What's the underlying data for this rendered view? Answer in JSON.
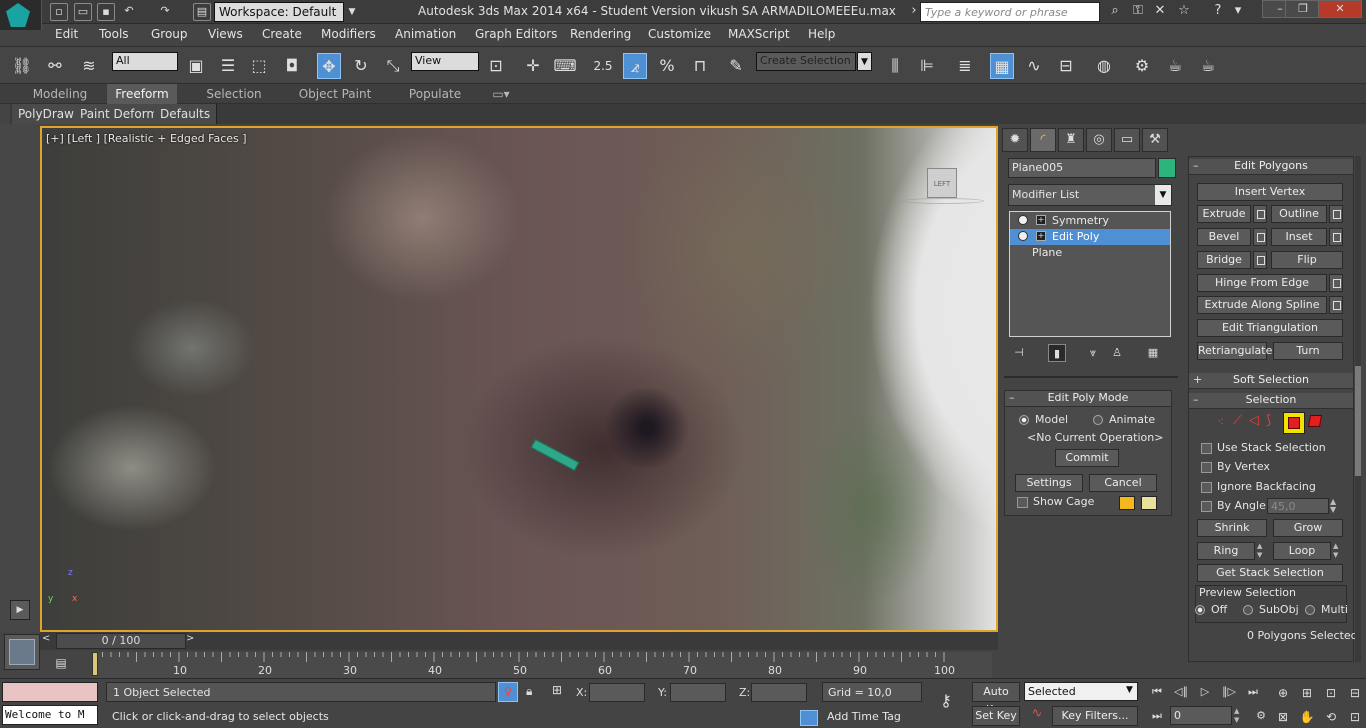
{
  "window": {
    "workspace": "Workspace: Default",
    "title": "Autodesk 3ds Max  2014 x64  - Student Version    vikush SA ARMADILOMEEEu.max",
    "search_placeholder": "Type a keyword or phrase"
  },
  "menu": [
    "Edit",
    "Tools",
    "Group",
    "Views",
    "Create",
    "Modifiers",
    "Animation",
    "Graph Editors",
    "Rendering",
    "Customize",
    "MAXScript",
    "Help"
  ],
  "toolbar": {
    "selection_filter": "All",
    "reference_coord": "View",
    "snap_value": "2.5",
    "named_selection_placeholder": "Create Selection Se"
  },
  "ribbon": {
    "tabs": [
      "Modeling",
      "Freeform",
      "Selection",
      "Object Paint",
      "Populate"
    ],
    "active_tab": "Freeform",
    "subtabs": [
      "PolyDraw",
      "Paint Deform",
      "Defaults"
    ]
  },
  "viewport": {
    "label": "[+] [Left ] [Realistic + Edged Faces ]",
    "viewcube_label": "LEFT",
    "axis": {
      "x": "x",
      "y": "y",
      "z": "z"
    }
  },
  "command_panel": {
    "object_name": "Plane005",
    "object_color": "#2bb37b",
    "modifier_list": "Modifier List",
    "stack": [
      {
        "label": "Symmetry",
        "selected": false
      },
      {
        "label": "Edit Poly",
        "selected": true
      },
      {
        "label": "Plane",
        "selected": false
      }
    ],
    "edit_poly_mode": {
      "title": "Edit Poly Mode",
      "model": "Model",
      "animate": "Animate",
      "current_op": "<No Current Operation>",
      "commit": "Commit",
      "settings": "Settings",
      "cancel": "Cancel",
      "show_cage": "Show Cage",
      "cage_color_1": "#f4b81c",
      "cage_color_2": "#e8e29a"
    },
    "edit_polygons": {
      "title": "Edit Polygons",
      "insert_vertex": "Insert Vertex",
      "extrude": "Extrude",
      "outline": "Outline",
      "bevel": "Bevel",
      "inset": "Inset",
      "bridge": "Bridge",
      "flip": "Flip",
      "hinge": "Hinge From Edge",
      "extrude_spline": "Extrude Along Spline",
      "edit_tri": "Edit Triangulation",
      "retriangulate": "Retriangulate",
      "turn": "Turn"
    },
    "soft_selection": "Soft Selection",
    "selection": {
      "title": "Selection",
      "use_stack": "Use Stack Selection",
      "by_vertex": "By Vertex",
      "ignore_backfacing": "Ignore Backfacing",
      "by_angle": "By Angle:",
      "angle_value": "45,0",
      "shrink": "Shrink",
      "grow": "Grow",
      "ring": "Ring",
      "loop": "Loop",
      "get_stack": "Get Stack Selection",
      "preview_title": "Preview Selection",
      "off": "Off",
      "subobj": "SubObj",
      "multi": "Multi",
      "count": "0 Polygons Selected"
    }
  },
  "timeline": {
    "frame_display": "0 / 100",
    "ticks": [
      "10",
      "20",
      "30",
      "40",
      "50",
      "60",
      "70",
      "80",
      "90",
      "100"
    ]
  },
  "status": {
    "listener": "Welcome to M",
    "selected": "1 Object Selected",
    "prompt": "Click or click-and-drag to select objects",
    "x_label": "X:",
    "y_label": "Y:",
    "z_label": "Z:",
    "grid": "Grid = 10,0",
    "add_time_tag": "Add Time Tag",
    "auto_key": "Auto Key",
    "set_key": "Set Key",
    "key_mode": "Selected",
    "key_filters": "Key Filters...",
    "frame": "0"
  }
}
